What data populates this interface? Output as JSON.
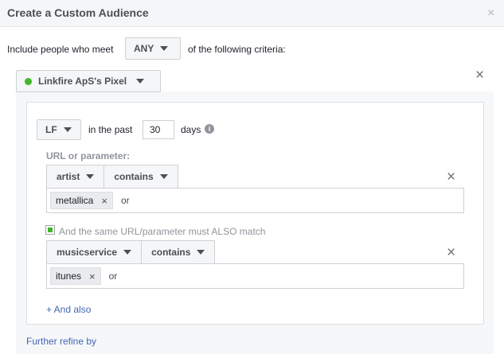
{
  "dialog": {
    "title": "Create a Custom Audience",
    "close_symbol": "×"
  },
  "criteria": {
    "prefix": "Include people who meet",
    "match_value": "ANY",
    "suffix": "of the following criteria:"
  },
  "pixel": {
    "name": "Linkfire ApS's Pixel",
    "status_color": "#42b72a",
    "remove_symbol": "×"
  },
  "rule": {
    "event_value": "LF",
    "past_label": "in the past",
    "days_value": "30",
    "days_label": "days",
    "info_symbol": "i",
    "url_label": "URL or parameter:",
    "conditions": [
      {
        "param": "artist",
        "operator": "contains",
        "token": "metallica",
        "or_label": "or",
        "remove_symbol": "×"
      },
      {
        "param": "musicservice",
        "operator": "contains",
        "token": "itunes",
        "or_label": "or",
        "remove_symbol": "×"
      }
    ],
    "also_match_label": "And the same URL/parameter must ALSO match",
    "and_also_label": "+ And also"
  },
  "further_refine_label": "Further refine by",
  "colors": {
    "accent_link": "#4267b2",
    "pixel_active": "#42b72a"
  }
}
